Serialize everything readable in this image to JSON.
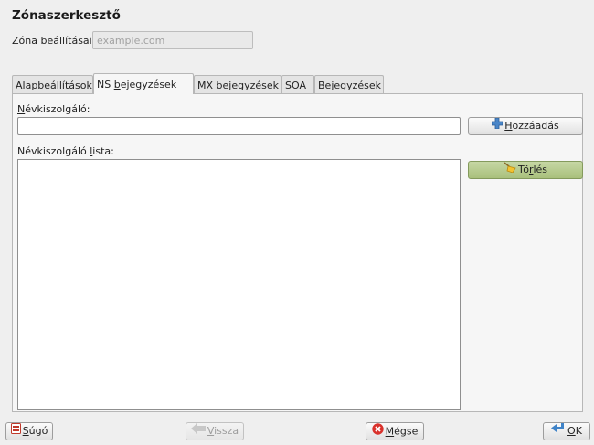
{
  "dialog": {
    "title": "Zónaszerkesztő"
  },
  "zone": {
    "label": "Zóna beállításai",
    "value": "example.com"
  },
  "tabs": [
    {
      "pre": "",
      "key": "A",
      "post": "lapbeállítások",
      "active": false
    },
    {
      "pre": "NS ",
      "key": "b",
      "post": "ejegyzések",
      "active": true
    },
    {
      "pre": "M",
      "key": "X",
      "post": " bejegyzések",
      "active": false
    },
    {
      "pre": "SOA",
      "key": "",
      "post": "",
      "active": false
    },
    {
      "pre": "Bejegyzések",
      "key": "",
      "post": "",
      "active": false
    }
  ],
  "ns_tab": {
    "nameserver_label": {
      "pre": "",
      "key": "N",
      "post": "évkiszolgáló:"
    },
    "nameserver_value": "",
    "add_button": {
      "pre": "",
      "key": "H",
      "post": "ozzáadás"
    },
    "list_label": {
      "pre": "Névkiszolgáló ",
      "key": "l",
      "post": "ista:"
    },
    "list_items": [],
    "delete_button": {
      "pre": "Tö",
      "key": "r",
      "post": "lés"
    }
  },
  "footer": {
    "help": {
      "pre": "",
      "key": "S",
      "post": "úgó"
    },
    "back": {
      "pre": "",
      "key": "V",
      "post": "issza"
    },
    "cancel": {
      "pre": "",
      "key": "M",
      "post": "égse"
    },
    "ok": {
      "pre": "",
      "key": "O",
      "post": "K"
    }
  },
  "icons": {
    "add": "plus-icon",
    "delete": "broom-icon",
    "help": "help-book-icon",
    "back": "back-arrow-icon",
    "cancel": "cancel-icon",
    "ok": "ok-arrow-icon"
  },
  "colors": {
    "accent_green": "#a9c07c",
    "cancel_red": "#d9322c",
    "arrow_blue": "#3f83c8"
  }
}
